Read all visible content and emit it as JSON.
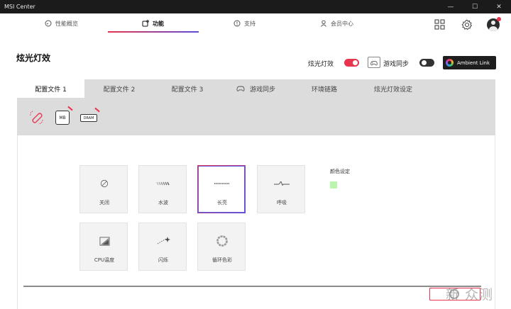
{
  "window": {
    "title": "MSI Center",
    "controls": [
      "—",
      "☐",
      "✕"
    ]
  },
  "topnav": {
    "tabs": [
      {
        "label": "性能概览",
        "icon": "gauge-icon"
      },
      {
        "label": "功能",
        "icon": "feature-icon"
      },
      {
        "label": "支持",
        "icon": "support-icon"
      },
      {
        "label": "会员中心",
        "icon": "member-icon"
      }
    ],
    "active": "功能"
  },
  "page": {
    "title": "炫光灯效"
  },
  "switches": {
    "lighting_label": "炫光灯效",
    "lighting_on": true,
    "game_sync_label": "游戏同步",
    "game_sync_on": false,
    "ambient_label": "Ambient Link"
  },
  "subtabs": [
    "配置文件 1",
    "配置文件 2",
    "配置文件 3",
    "游戏同步",
    "环境链路",
    "炫光灯效设定"
  ],
  "devices": [
    {
      "name": "link-device-icon"
    },
    {
      "name": "mainboard-icon",
      "label": "MB"
    },
    {
      "name": "dram-icon",
      "label": "DRAM"
    }
  ],
  "effects": [
    {
      "label": "关闭",
      "icon": "off-icon"
    },
    {
      "label": "水波",
      "icon": "wave-icon"
    },
    {
      "label": "长亮",
      "icon": "steady-icon",
      "selected": true
    },
    {
      "label": "呼吸",
      "icon": "breathing-icon"
    },
    {
      "label": "CPU温度",
      "icon": "cpu-temp-icon"
    },
    {
      "label": "闪烁",
      "icon": "flash-icon"
    },
    {
      "label": "循环色彩",
      "icon": "color-cycle-icon"
    }
  ],
  "color_setting": {
    "label": "颜色设定",
    "color": "#b9f5ad"
  },
  "apply_label": "",
  "watermark": "新 众测",
  "colors": {
    "accent_red": "#e8344e",
    "accent_purple": "#5a4cd8"
  }
}
